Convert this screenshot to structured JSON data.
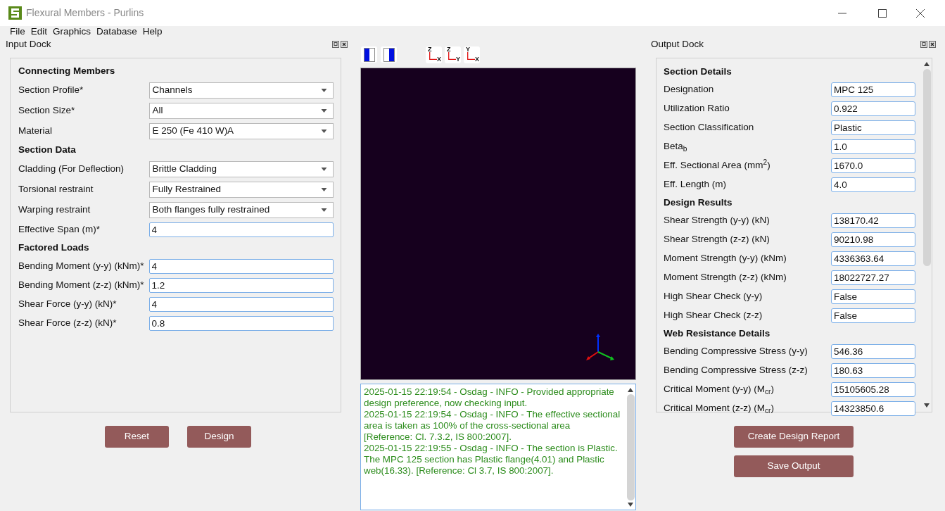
{
  "window": {
    "title": "Flexural Members - Purlins"
  },
  "menu": [
    "File",
    "Edit",
    "Graphics",
    "Database",
    "Help"
  ],
  "input_dock": {
    "title": "Input Dock",
    "rows": [
      {
        "kind": "header",
        "label": "Connecting Members"
      },
      {
        "kind": "dropdown",
        "label": "Section Profile*",
        "value": "Channels"
      },
      {
        "kind": "dropdown",
        "label": "Section Size*",
        "value": "All"
      },
      {
        "kind": "dropdown",
        "label": "Material",
        "value": "E 250 (Fe 410 W)A"
      },
      {
        "kind": "header",
        "label": "Section Data"
      },
      {
        "kind": "dropdown",
        "label": "Cladding (For Deflection)",
        "value": "Brittle Cladding"
      },
      {
        "kind": "dropdown",
        "label": "Torsional restraint",
        "value": "Fully Restrained"
      },
      {
        "kind": "dropdown",
        "label": "Warping restraint",
        "value": "Both flanges fully restrained"
      },
      {
        "kind": "text",
        "label": "Effective Span (m)*",
        "value": "4"
      },
      {
        "kind": "header",
        "label": "Factored Loads"
      },
      {
        "kind": "text",
        "label": "Bending Moment (y-y) (kNm)*",
        "value": "4"
      },
      {
        "kind": "text",
        "label": "Bending Moment (z-z) (kNm)*",
        "value": "1.2"
      },
      {
        "kind": "text",
        "label": "Shear Force (y-y) (kN)*",
        "value": "4"
      },
      {
        "kind": "text",
        "label": "Shear Force (z-z) (kN)*",
        "value": "0.8"
      }
    ],
    "buttons": [
      "Reset",
      "Design"
    ]
  },
  "viewer": {
    "view_buttons": [
      {
        "up": "Z",
        "right": "X"
      },
      {
        "up": "Z",
        "right": "Y"
      },
      {
        "up": "Y",
        "right": "X"
      }
    ]
  },
  "log": [
    "2025-01-15 22:19:54 - Osdag - INFO - Provided appropriate design preference, now checking input.",
    "2025-01-15 22:19:54 - Osdag - INFO - The effective sectional area is taken as 100% of the cross-sectional area [Reference: Cl. 7.3.2, IS 800:2007].",
    "2025-01-15 22:19:55 - Osdag - INFO - The section is Plastic. The MPC 125 section has Plastic flange(4.01) and Plastic web(16.33). [Reference: Cl 3.7, IS 800:2007]."
  ],
  "output_dock": {
    "title": "Output Dock",
    "rows": [
      {
        "kind": "header",
        "label": "Section Details"
      },
      {
        "kind": "field",
        "label": "Designation",
        "value": "MPC 125"
      },
      {
        "kind": "field",
        "label": "Utilization Ratio",
        "value": "0.922"
      },
      {
        "kind": "field",
        "label": "Section Classification",
        "value": "Plastic"
      },
      {
        "kind": "field",
        "label": "Beta$_{b}$",
        "value": "1.0"
      },
      {
        "kind": "field",
        "label": "Eff. Sectional Area (mm$^{2}$)",
        "value": "1670.0"
      },
      {
        "kind": "field",
        "label": "Eff. Length (m)",
        "value": "4.0"
      },
      {
        "kind": "header",
        "label": "Design Results"
      },
      {
        "kind": "field",
        "label": "Shear Strength (y-y) (kN)",
        "value": "138170.42"
      },
      {
        "kind": "field",
        "label": "Shear Strength (z-z) (kN)",
        "value": "90210.98"
      },
      {
        "kind": "field",
        "label": "Moment Strength (y-y) (kNm)",
        "value": "4336363.64"
      },
      {
        "kind": "field",
        "label": "Moment Strength (z-z) (kNm)",
        "value": "18022727.27"
      },
      {
        "kind": "field",
        "label": "High Shear Check (y-y)",
        "value": "False"
      },
      {
        "kind": "field",
        "label": "High Shear Check (z-z)",
        "value": "False"
      },
      {
        "kind": "header",
        "label": "Web Resistance Details"
      },
      {
        "kind": "field",
        "label": "Bending Compressive Stress (y-y)",
        "value": "546.36"
      },
      {
        "kind": "field",
        "label": "Bending Compressive Stress (z-z)",
        "value": "180.63"
      },
      {
        "kind": "field",
        "label": "Critical Moment (y-y) (M$_{cr}$)",
        "value": "15105605.28"
      },
      {
        "kind": "field",
        "label": "Critical Moment (z-z) (M$_{cr}$)",
        "value": "14323850.6"
      }
    ],
    "buttons": [
      "Create Design Report",
      "Save Output"
    ]
  }
}
